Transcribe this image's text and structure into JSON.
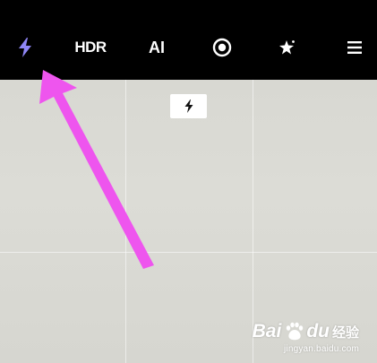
{
  "toolbar": {
    "items": [
      {
        "id": "flash",
        "icon": "lightning-bolt-icon",
        "color": "#8f86f5"
      },
      {
        "id": "hdr",
        "label": "HDR",
        "icon": "hdr-icon"
      },
      {
        "id": "ai",
        "label": "AI"
      },
      {
        "id": "live",
        "icon": "live-photo-icon"
      },
      {
        "id": "filter",
        "icon": "magic-star-icon"
      },
      {
        "id": "menu",
        "icon": "hamburger-menu-icon"
      }
    ]
  },
  "viewfinder": {
    "flash_indicator_icon": "lightning-bolt-icon",
    "grid": "3x3"
  },
  "annotation": {
    "type": "arrow",
    "color": "#ee55ee"
  },
  "watermark": {
    "brand": "Bai",
    "brand_suffix": "du",
    "jingyan": "经验",
    "url": "jingyan.baidu.com"
  }
}
